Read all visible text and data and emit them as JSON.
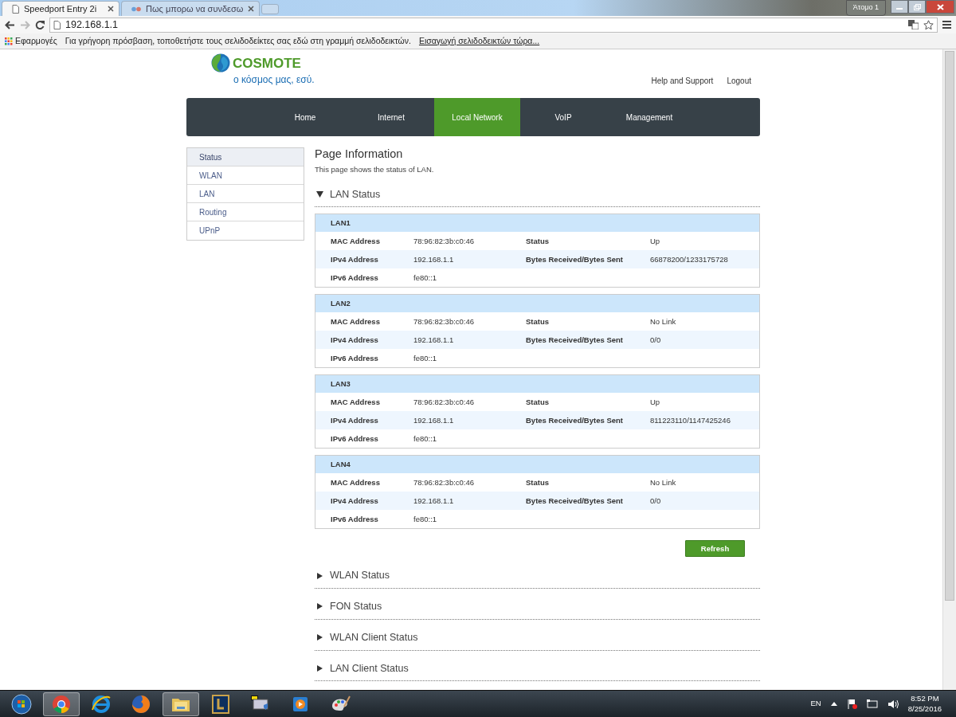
{
  "browser": {
    "tabs": [
      {
        "title": "Speedport Entry 2i",
        "selected": true
      },
      {
        "title": "Πως μπορω να συνδεσω",
        "selected": false
      }
    ],
    "profile": "Άτομο 1",
    "address": "192.168.1.1",
    "bookmarks_bar": {
      "apps": "Εφαρμογές",
      "hint": "Για γρήγορη πρόσβαση, τοποθετήστε τους σελιδοδείκτες σας εδώ στη γραμμή σελιδοδεικτών.",
      "link": "Εισαγωγή σελιδοδεικτών τώρα..."
    }
  },
  "page": {
    "logo": {
      "brand": "COSMOTE",
      "slogan": "ο κόσμος μας, εσύ."
    },
    "header_links": [
      "Help and Support",
      "Logout"
    ],
    "nav": [
      {
        "label": "Home",
        "selected": false
      },
      {
        "label": "Internet",
        "selected": false
      },
      {
        "label": "Local Network",
        "selected": true
      },
      {
        "label": "VoIP",
        "selected": false
      },
      {
        "label": "Management",
        "selected": false
      }
    ],
    "sidebar": [
      {
        "label": "Status",
        "selected": true
      },
      {
        "label": "WLAN",
        "selected": false
      },
      {
        "label": "LAN",
        "selected": false
      },
      {
        "label": "Routing",
        "selected": false
      },
      {
        "label": "UPnP",
        "selected": false
      }
    ],
    "title": "Page Information",
    "description": "This page shows the status of LAN.",
    "sections": [
      {
        "title": "LAN Status",
        "expanded": true,
        "ports": [
          {
            "name": "LAN1",
            "rows": [
              [
                "MAC Address",
                "78:96:82:3b:c0:46",
                "Status",
                "Up"
              ],
              [
                "IPv4 Address",
                "192.168.1.1",
                "Bytes Received/Bytes Sent",
                "66878200/1233175728"
              ],
              [
                "IPv6 Address",
                "fe80::1"
              ]
            ]
          },
          {
            "name": "LAN2",
            "rows": [
              [
                "MAC Address",
                "78:96:82:3b:c0:46",
                "Status",
                "No Link"
              ],
              [
                "IPv4 Address",
                "192.168.1.1",
                "Bytes Received/Bytes Sent",
                "0/0"
              ],
              [
                "IPv6 Address",
                "fe80::1"
              ]
            ]
          },
          {
            "name": "LAN3",
            "rows": [
              [
                "MAC Address",
                "78:96:82:3b:c0:46",
                "Status",
                "Up"
              ],
              [
                "IPv4 Address",
                "192.168.1.1",
                "Bytes Received/Bytes Sent",
                "811223110/1147425246"
              ],
              [
                "IPv6 Address",
                "fe80::1"
              ]
            ]
          },
          {
            "name": "LAN4",
            "rows": [
              [
                "MAC Address",
                "78:96:82:3b:c0:46",
                "Status",
                "No Link"
              ],
              [
                "IPv4 Address",
                "192.168.1.1",
                "Bytes Received/Bytes Sent",
                "0/0"
              ],
              [
                "IPv6 Address",
                "fe80::1"
              ]
            ]
          }
        ],
        "button": "Refresh"
      },
      {
        "title": "WLAN Status",
        "expanded": false
      },
      {
        "title": "FON Status",
        "expanded": false
      },
      {
        "title": "WLAN Client Status",
        "expanded": false
      },
      {
        "title": "LAN Client Status",
        "expanded": false
      }
    ]
  },
  "tray": {
    "language": "EN",
    "time": "8:52 PM",
    "date": "8/25/2016"
  }
}
